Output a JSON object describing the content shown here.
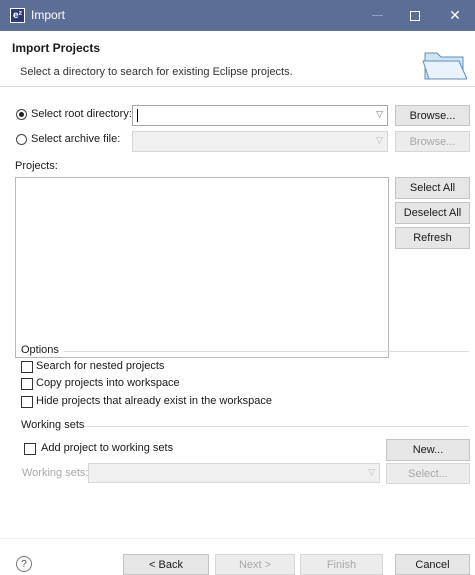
{
  "window": {
    "icon_text": "e²",
    "title": "Import"
  },
  "header": {
    "title": "Import Projects",
    "description": "Select a directory to search for existing Eclipse projects."
  },
  "source": {
    "root_dir_label": "Select root directory:",
    "root_dir_value": "",
    "root_dir_selected": true,
    "archive_label": "Select archive file:",
    "archive_value": "",
    "archive_selected": false,
    "browse_label": "Browse...",
    "browse_archive_label": "Browse..."
  },
  "projects": {
    "label": "Projects:",
    "items": [],
    "select_all_label": "Select All",
    "deselect_all_label": "Deselect All",
    "refresh_label": "Refresh"
  },
  "options": {
    "title": "Options",
    "search_nested_label": "Search for nested projects",
    "copy_projects_label": "Copy projects into workspace",
    "hide_existing_label": "Hide projects that already exist in the workspace"
  },
  "working_sets": {
    "title": "Working sets",
    "add_label": "Add project to working sets",
    "new_label": "New...",
    "sets_label": "Working sets:",
    "sets_value": "",
    "select_label": "Select..."
  },
  "footer": {
    "help_symbol": "?",
    "back_label": "< Back",
    "next_label": "Next >",
    "finish_label": "Finish",
    "cancel_label": "Cancel"
  }
}
